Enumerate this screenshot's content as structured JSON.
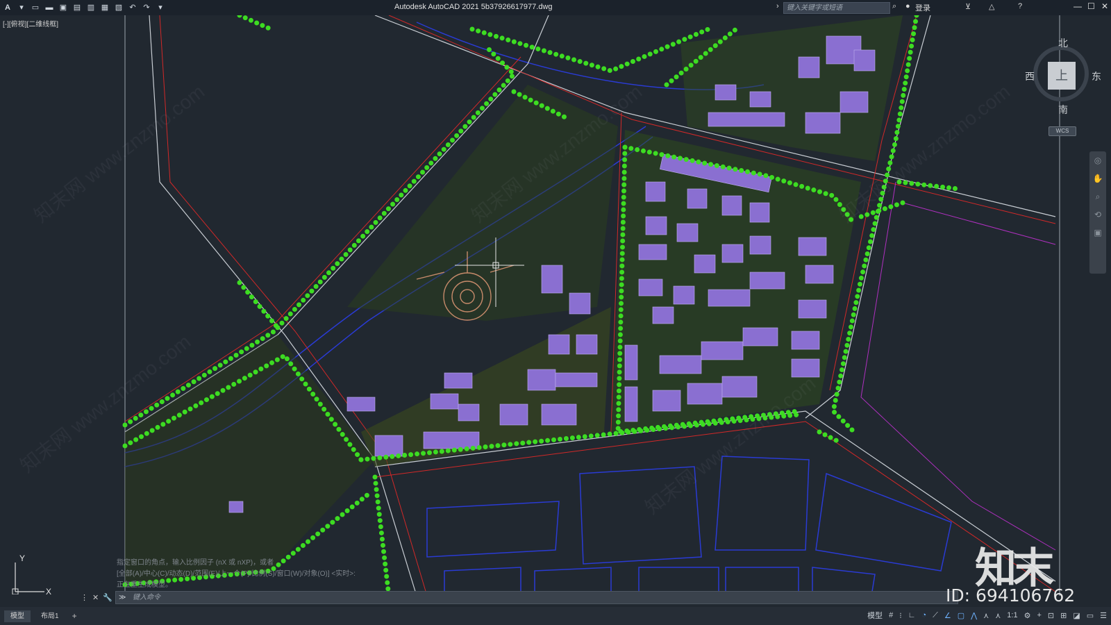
{
  "app": {
    "title": "Autodesk AutoCAD 2021    5b37926617977.dwg",
    "logo": "A",
    "search_placeholder": "键入关键字或短语",
    "login": "登录"
  },
  "toolbar": {
    "icons": [
      "new-icon",
      "open-icon",
      "save-icon",
      "saveas-icon",
      "publish-icon",
      "plot-preview-icon",
      "print-icon",
      "undo-icon",
      "redo-icon",
      "customize-icon"
    ]
  },
  "viewport": {
    "label": "[-][俯视][二维线框]"
  },
  "viewcube": {
    "north": "北",
    "south": "南",
    "west": "西",
    "east": "东",
    "face": "上",
    "wcs": "WCS"
  },
  "ucs": {
    "x": "X",
    "y": "Y"
  },
  "command": {
    "placeholder": "键入命令",
    "prompt": "≫",
    "history": [
      "指定窗口的角点，输入比例因子 (nX 或 nXP)，或者",
      "[全部(A)/中心(C)/动态(D)/范围(E)/上一个(P)/比例(S)/窗口(W)/对象(O)] <实时>:",
      "正在重生成模型。"
    ]
  },
  "layout_tabs": [
    "模型",
    "布局1",
    "+"
  ],
  "statusbar": {
    "model": "模型",
    "scale": "1:1"
  },
  "watermark": {
    "logo": "知末",
    "id": "ID: 694106762",
    "site": "知末网 www.znzmo.com"
  },
  "colors": {
    "background": "#212830",
    "trees": "#3ddc22",
    "roads": "#d22828",
    "buildings": "#8a6fd1",
    "water": "#2a3bd4"
  }
}
